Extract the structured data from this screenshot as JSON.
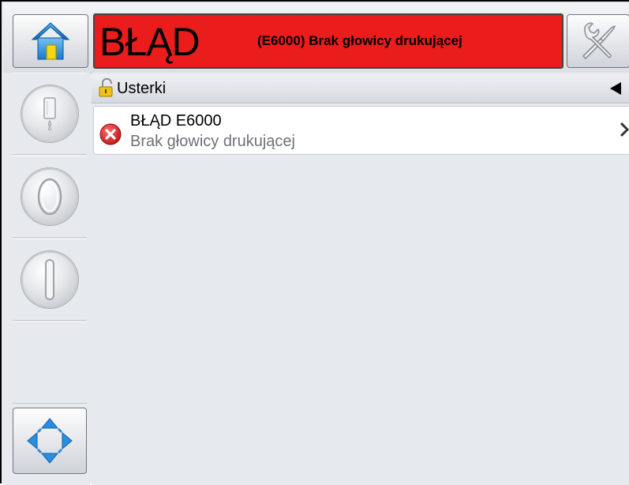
{
  "header": {
    "status_title": "BŁĄD",
    "status_message": "(E6000) Brak głowicy drukującej",
    "status_color": "#ea1c1c"
  },
  "icons": {
    "home": "home-icon",
    "tools": "tools-icon",
    "lock": "padlock-unlocked-icon",
    "collapse": "triangle-left-icon",
    "error": "error-x-icon",
    "chevron": "chevron-right-icon",
    "navigation": "four-way-arrows-icon"
  },
  "section": {
    "title": "Usterki"
  },
  "faults": [
    {
      "title": "BŁĄD E6000",
      "description": "Brak głowicy drukującej"
    }
  ]
}
